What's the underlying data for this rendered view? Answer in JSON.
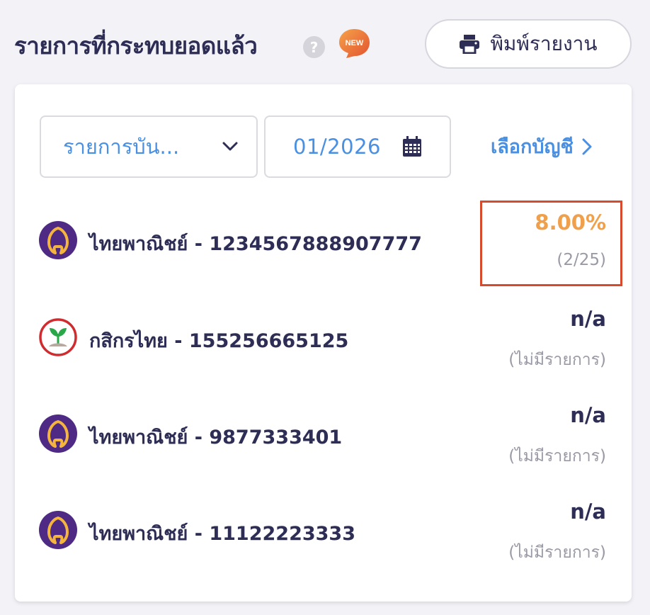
{
  "header": {
    "title": "รายการที่กระทบยอดแล้ว",
    "help_glyph": "?",
    "new_badge": "NEW",
    "print_label": "พิมพ์รายงาน"
  },
  "filters": {
    "type_select_value": "รายการบัน...",
    "date_value": "01/2026",
    "select_account_label": "เลือกบัญชี"
  },
  "accounts": [
    {
      "label": "ไทยพาณิชย์ - 1234567888907777",
      "value": "8.00%",
      "sub": "(2/25)",
      "bank_icon": "scb-icon"
    },
    {
      "label": "กสิกรไทย - 155256665125",
      "value": "n/a",
      "sub": "(ไม่มีรายการ)",
      "bank_icon": "kbank-icon"
    },
    {
      "label": "ไทยพาณิชย์ - 9877333401",
      "value": "n/a",
      "sub": "(ไม่มีรายการ)",
      "bank_icon": "scb-icon"
    },
    {
      "label": "ไทยพาณิชย์ - 11122223333",
      "value": "n/a",
      "sub": "(ไม่มีรายการ)",
      "bank_icon": "scb-icon"
    }
  ],
  "colors": {
    "accent_blue": "#4a90e2",
    "highlight_orange": "#f0a04b",
    "highlight_border": "#d64a2e",
    "scb_purple": "#4e2a84",
    "scb_gold": "#f4b53f",
    "kbank_green": "#2aa748",
    "kbank_red": "#d02c2f"
  }
}
